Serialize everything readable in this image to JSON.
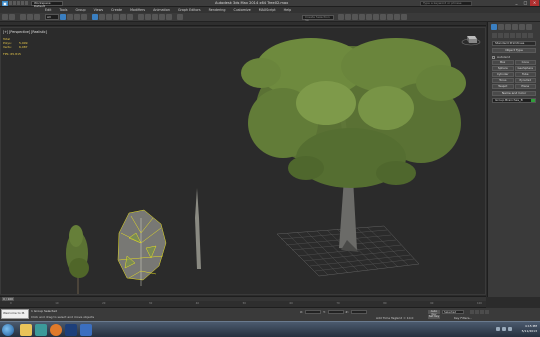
{
  "title_bar": {
    "app_title": "Autodesk 3ds Max  2014 x64     Tree02.max",
    "workspace": "Workspace: Default",
    "help_search": "Type a keyword or phrase",
    "window_buttons": [
      "_",
      "□",
      "×"
    ]
  },
  "menu": [
    "Edit",
    "Tools",
    "Group",
    "Views",
    "Create",
    "Modifiers",
    "Animation",
    "Graph Editors",
    "Rendering",
    "Customize",
    "MAXScript",
    "Help"
  ],
  "toolbar": {
    "selection_filter": "All",
    "named_selection_set": "Create Selection Se"
  },
  "viewport": {
    "label": "[+] [Perspective] [Realistic]",
    "stats": [
      {
        "key": "Total",
        "value": ""
      },
      {
        "key": "Polys:",
        "value": "5,999"
      },
      {
        "key": "Verts:",
        "value": "6,087"
      }
    ],
    "fps": "FPS:   65.815"
  },
  "command_panel": {
    "category_dropdown": "Standard Primitives",
    "object_type_header": "Object Type",
    "autogrid_label": "AutoGrid",
    "buttons": [
      "Box",
      "Cone",
      "Sphere",
      "GeoSphere",
      "Cylinder",
      "Tube",
      "Torus",
      "Pyramid",
      "Teapot",
      "Plane"
    ],
    "name_color_header": "Name and Color",
    "name_value": "Group.Branches_B"
  },
  "timeline": {
    "slider": "0 / 100",
    "ticks": [
      "0",
      "10",
      "20",
      "30",
      "40",
      "50",
      "60",
      "70",
      "80",
      "90",
      "100"
    ]
  },
  "status_bar": {
    "maxscript_text": "Welcome to M.",
    "message_1": "1 Group Selected",
    "message_2": "Click and drag to select and move objects",
    "coord_x_label": "X:",
    "coord_y_label": "Y:",
    "coord_z_label": "Z:",
    "grid": "Grid = 10.0",
    "add_time_tag": "Add Time Tag",
    "auto_key": "Auto Key",
    "selected_dropdown": "Selected",
    "set_key": "Set Key",
    "key_filters": "Key Filters..."
  },
  "taskbar": {
    "time": "4:15 PM",
    "date": "5/11/2013"
  },
  "icons": {
    "start": "windows-start-icon",
    "apps": [
      "explorer-icon",
      "3dsmax-icon",
      "firefox-icon",
      "photoshop-icon",
      "mediaplayer-icon"
    ]
  },
  "colors": {
    "viewport_bg": "#2b2b2b",
    "accent": "#3a7fc1",
    "stats_text": "#e8c84a",
    "foliage": "#6e8a3e",
    "wireframe": "#e8e020"
  }
}
